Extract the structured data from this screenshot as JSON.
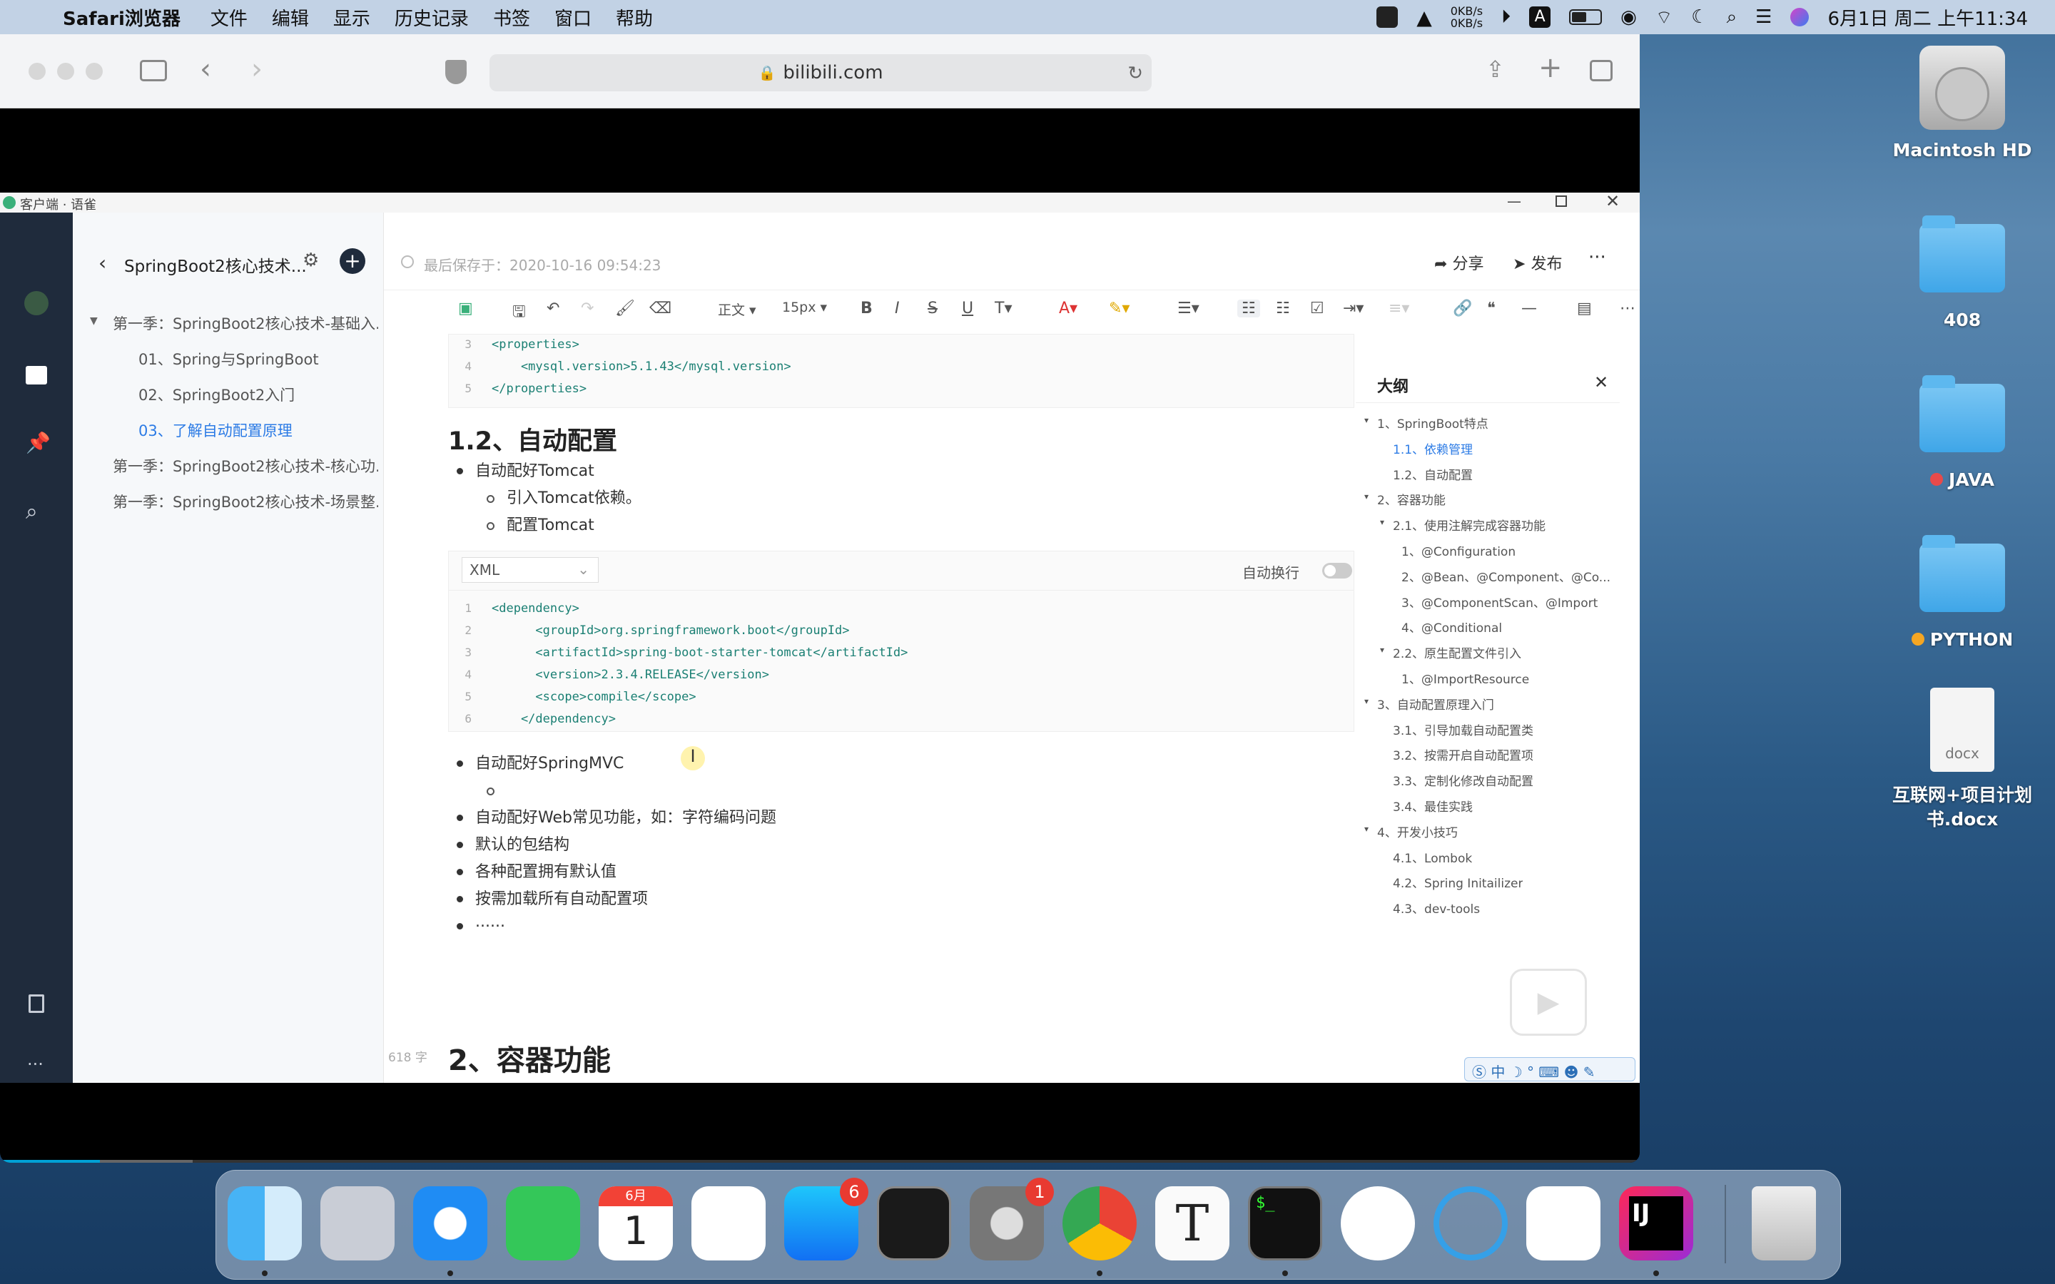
{
  "menubar": {
    "app_name": "Safari浏览器",
    "menus": [
      "文件",
      "编辑",
      "显示",
      "历史记录",
      "书签",
      "窗口",
      "帮助"
    ],
    "net_up": "0KB/s",
    "net_down": "0KB/s",
    "clock": "6月1日 周二 上午11:34"
  },
  "safari": {
    "url": "bilibili.com"
  },
  "app": {
    "window_title": "客户端 · 语雀",
    "book_title": "SpringBoot2核心技术...",
    "save_status": "最后保存于：2020-10-16 09:54:23",
    "share_label": "分享",
    "publish_label": "发布",
    "toolbar": {
      "style": "正文",
      "font_size": "15px"
    },
    "nav_items": [
      {
        "label": "第一季：SpringBoot2核心技术-基础入...",
        "level": 0
      },
      {
        "label": "01、Spring与SpringBoot",
        "level": 1
      },
      {
        "label": "02、SpringBoot2入门",
        "level": 1
      },
      {
        "label": "03、了解自动配置原理",
        "level": 1,
        "active": true
      },
      {
        "label": "第一季：SpringBoot2核心技术-核心功...",
        "level": 0
      },
      {
        "label": "第一季：SpringBoot2核心技术-场景整...",
        "level": 0
      }
    ],
    "code_top": {
      "lines": [
        {
          "n": "3",
          "text": "<properties>"
        },
        {
          "n": "4",
          "text": "    <mysql.version>5.1.43</mysql.version>"
        },
        {
          "n": "5",
          "text": "</properties>"
        }
      ]
    },
    "heading_1_2": "1.2、自动配置",
    "bullets_a": [
      {
        "text": "自动配好Tomcat",
        "level": 0
      },
      {
        "text": "引入Tomcat依赖。",
        "level": 1
      },
      {
        "text": "配置Tomcat",
        "level": 1
      }
    ],
    "code_block": {
      "lang": "XML",
      "wrap_label": "自动换行",
      "lines": [
        {
          "n": "1",
          "text": "<dependency>"
        },
        {
          "n": "2",
          "text": "      <groupId>org.springframework.boot</groupId>"
        },
        {
          "n": "3",
          "text": "      <artifactId>spring-boot-starter-tomcat</artifactId>"
        },
        {
          "n": "4",
          "text": "      <version>2.3.4.RELEASE</version>"
        },
        {
          "n": "5",
          "text": "      <scope>compile</scope>"
        },
        {
          "n": "6",
          "text": "    </dependency>"
        }
      ]
    },
    "bullets_b": [
      {
        "text": "自动配好SpringMVC",
        "level": 0
      },
      {
        "text": "",
        "level": 1
      },
      {
        "text": "自动配好Web常见功能，如：字符编码问题",
        "level": 0
      },
      {
        "text": "默认的包结构",
        "level": 0
      },
      {
        "text": "各种配置拥有默认值",
        "level": 0
      },
      {
        "text": "按需加载所有自动配置项",
        "level": 0
      },
      {
        "text": "......",
        "level": 0
      }
    ],
    "word_count": "618 字",
    "heading_2": "2、容器功能",
    "outline_title": "大纲",
    "outline": [
      {
        "text": "1、SpringBoot特点",
        "level": 0
      },
      {
        "text": "1.1、依赖管理",
        "level": 1,
        "active": true
      },
      {
        "text": "1.2、自动配置",
        "level": 1
      },
      {
        "text": "2、容器功能",
        "level": 0
      },
      {
        "text": "2.1、使用注解完成容器功能",
        "level": 1
      },
      {
        "text": "1、@Configuration",
        "level": 2
      },
      {
        "text": "2、@Bean、@Component、@Co...",
        "level": 2
      },
      {
        "text": "3、@ComponentScan、@Import",
        "level": 2
      },
      {
        "text": "4、@Conditional",
        "level": 2
      },
      {
        "text": "2.2、原生配置文件引入",
        "level": 1
      },
      {
        "text": "1、@ImportResource",
        "level": 2
      },
      {
        "text": "3、自动配置原理入门",
        "level": 0
      },
      {
        "text": "3.1、引导加载自动配置类",
        "level": 1
      },
      {
        "text": "3.2、按需开启自动配置项",
        "level": 1
      },
      {
        "text": "3.3、定制化修改自动配置",
        "level": 1
      },
      {
        "text": "3.4、最佳实践",
        "level": 1
      },
      {
        "text": "4、开发小技巧",
        "level": 0
      },
      {
        "text": "4.1、Lombok",
        "level": 1
      },
      {
        "text": "4.2、Spring Initailizer",
        "level": 1
      },
      {
        "text": "4.3、dev-tools",
        "level": 1
      }
    ],
    "ime_label": "中"
  },
  "desktop": {
    "icons": [
      {
        "label": "Macintosh HD"
      },
      {
        "label": "408"
      },
      {
        "label": "JAVA",
        "tag_color": "#e84a4a"
      },
      {
        "label": "PYTHON",
        "tag_color": "#f5a623"
      },
      {
        "label": "互联网+项目计划书.docx",
        "doc_ext": "docx"
      }
    ]
  },
  "dock": {
    "calendar_month": "6月",
    "calendar_day": "1",
    "appstore_badge": "6",
    "settings_badge": "1",
    "apps": [
      "Finder",
      "Launchpad",
      "Safari",
      "FaceTime",
      "Calendar",
      "Reminders",
      "App Store",
      "Activity Monitor",
      "System Preferences",
      "Chrome",
      "Typora",
      "Terminal",
      "Git tool",
      "Navicat",
      "VS Code",
      "IntelliJ IDEA",
      "Trash"
    ]
  },
  "colors": {
    "accent": "#1890ff",
    "active_nav": "#2c7be5",
    "rail": "#1f2b3c",
    "code_green": "#1a7f73"
  }
}
